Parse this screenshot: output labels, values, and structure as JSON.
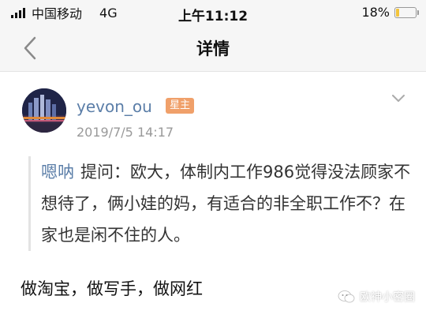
{
  "status_bar": {
    "carrier": "中国移动",
    "network": "4G",
    "time": "上午11:12",
    "battery_percent": "18%",
    "battery_level": 0.18
  },
  "nav": {
    "title": "详情"
  },
  "post": {
    "username": "yevon_ou",
    "badge": "星主",
    "timestamp": "2019/7/5 14:17",
    "quote": {
      "asker": "嗯呐",
      "text": "提问：欧大，体制内工作986觉得没法顾家不想待了，俩小娃的妈，有适合的非全职工作不？在家也是闲不住的人。"
    },
    "answer": "做淘宝，做写手，做网红"
  },
  "watermark": {
    "text": "欧神小密圈"
  },
  "colors": {
    "link_blue": "#5b7ea8",
    "badge_orange": "#f0a06a",
    "battery_yellow": "#f3c43a"
  }
}
